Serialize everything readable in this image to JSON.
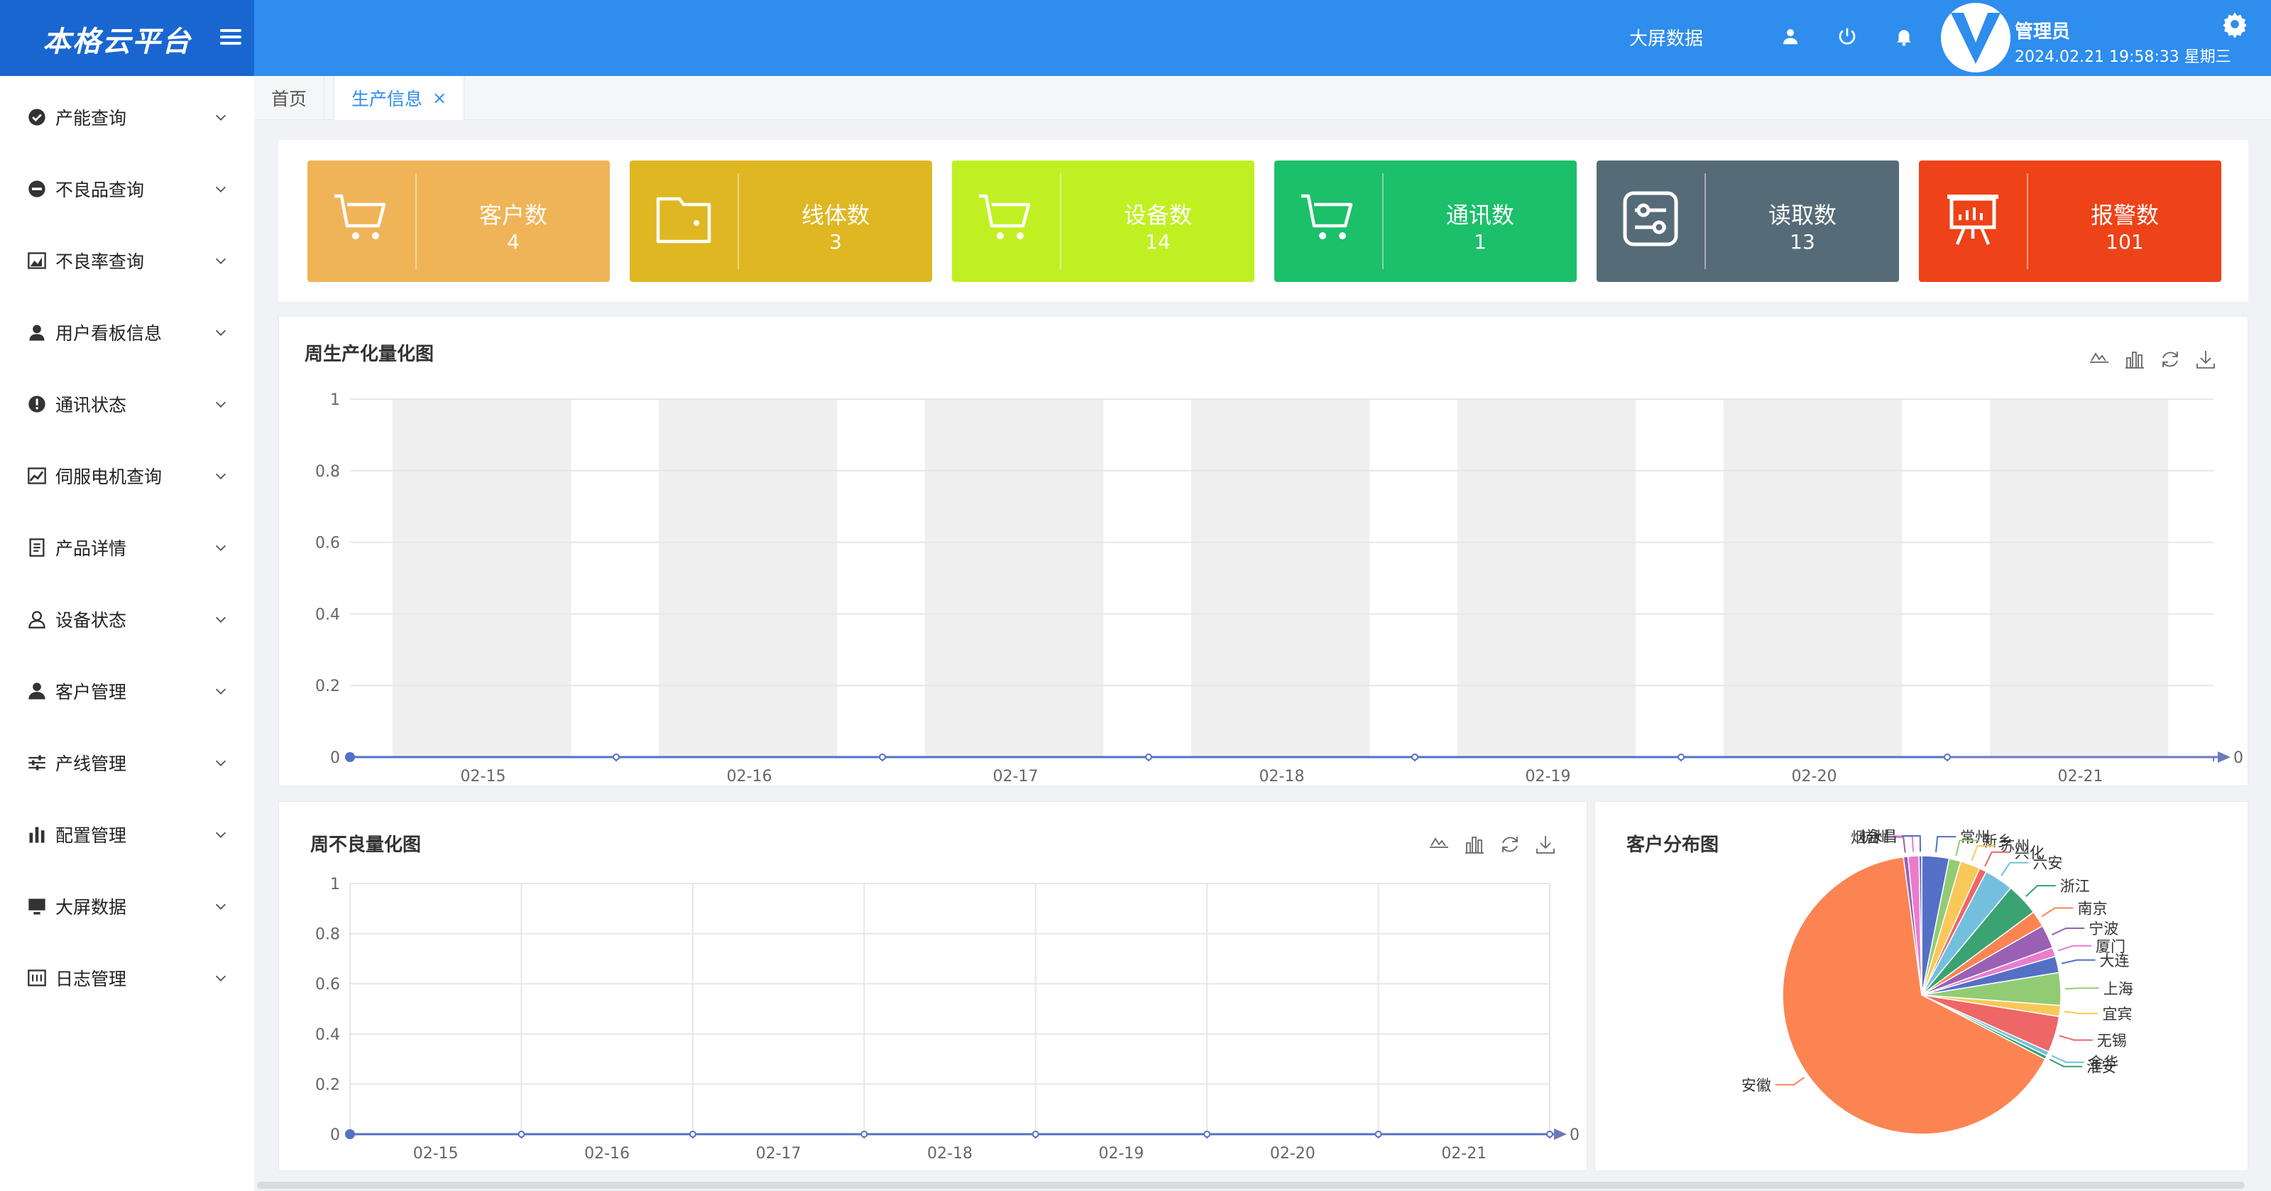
{
  "app": {
    "logo_text": "本格云平台"
  },
  "header": {
    "big_screen_label": "大屏数据",
    "user_name": "管理员",
    "user_time": "2024.02.21 19:58:33 星期三",
    "icons": [
      "user-icon",
      "power-icon",
      "bell-icon",
      "settings-icon"
    ]
  },
  "sidebar": {
    "items": [
      {
        "label": "产能查询",
        "icon": "check-circle-icon"
      },
      {
        "label": "不良品查询",
        "icon": "minus-circle-icon"
      },
      {
        "label": "不良率查询",
        "icon": "area-chart-icon"
      },
      {
        "label": "用户看板信息",
        "icon": "user-icon"
      },
      {
        "label": "通讯状态",
        "icon": "exclamation-circle-icon"
      },
      {
        "label": "伺服电机查询",
        "icon": "line-chart-icon"
      },
      {
        "label": "产品详情",
        "icon": "document-icon"
      },
      {
        "label": "设备状态",
        "icon": "user-outline-icon"
      },
      {
        "label": "客户管理",
        "icon": "person-icon"
      },
      {
        "label": "产线管理",
        "icon": "sliders-icon"
      },
      {
        "label": "配置管理",
        "icon": "bar-chart-icon"
      },
      {
        "label": "大屏数据",
        "icon": "monitor-icon"
      },
      {
        "label": "日志管理",
        "icon": "log-icon"
      }
    ]
  },
  "tabs": {
    "home": "首页",
    "active": "生产信息",
    "close_glyph": "×"
  },
  "cards": [
    {
      "label": "客户数",
      "value": "4",
      "color": "#f0b458",
      "icon": "cart-icon"
    },
    {
      "label": "线体数",
      "value": "3",
      "color": "#deb722",
      "icon": "wallet-icon"
    },
    {
      "label": "设备数",
      "value": "14",
      "color": "#c0f022",
      "icon": "cart-icon"
    },
    {
      "label": "通讯数",
      "value": "1",
      "color": "#1cbf6a",
      "icon": "cart-icon"
    },
    {
      "label": "读取数",
      "value": "13",
      "color": "#566b78",
      "icon": "settings-panel-icon"
    },
    {
      "label": "报警数",
      "value": "101",
      "color": "#ee4218",
      "icon": "presentation-icon"
    }
  ],
  "weekly_production": {
    "title": "周生产化量化图",
    "toolbox": [
      "line-switch-icon",
      "bar-switch-icon",
      "restore-icon",
      "download-icon"
    ]
  },
  "weekly_defects": {
    "title": "周不良量化图",
    "toolbox": [
      "line-switch-icon",
      "bar-switch-icon",
      "restore-icon",
      "download-icon"
    ]
  },
  "customer_distribution": {
    "title": "客户分布图"
  },
  "chart_data": [
    {
      "type": "line",
      "title": "周生产化量化图",
      "categories": [
        "02-15",
        "02-16",
        "02-17",
        "02-18",
        "02-19",
        "02-20",
        "02-21"
      ],
      "series": [
        {
          "values": [
            0,
            0,
            0,
            0,
            0,
            0,
            0
          ],
          "color": "#5470c6"
        }
      ],
      "y_ticks": [
        "0",
        "0.2",
        "0.4",
        "0.6",
        "0.8",
        "1"
      ],
      "ylim": [
        0,
        1
      ],
      "x_axis_end_label": "0",
      "split_area": true,
      "grid": true
    },
    {
      "type": "line",
      "title": "周不良量化图",
      "categories": [
        "02-15",
        "02-16",
        "02-17",
        "02-18",
        "02-19",
        "02-20",
        "02-21"
      ],
      "series": [
        {
          "values": [
            0,
            0,
            0,
            0,
            0,
            0,
            0,
            0
          ],
          "color": "#5470c6"
        }
      ],
      "y_ticks": [
        "0",
        "0.2",
        "0.4",
        "0.6",
        "0.8",
        "1"
      ],
      "ylim": [
        0,
        1
      ],
      "x_axis_end_label": "0",
      "grid": true
    },
    {
      "type": "pie",
      "title": "客户分布图",
      "slices": [
        {
          "label": "常州",
          "value": 3.0,
          "color": "#5470c6"
        },
        {
          "label": "新乡",
          "value": 1.3,
          "color": "#91cc75"
        },
        {
          "label": "苏州",
          "value": 2.2,
          "color": "#fac858"
        },
        {
          "label": "兴化",
          "value": 0.8,
          "color": "#ee6666"
        },
        {
          "label": "六安",
          "value": 3.2,
          "color": "#73c0de"
        },
        {
          "label": "浙江",
          "value": 3.6,
          "color": "#3ba272"
        },
        {
          "label": "南京",
          "value": 1.8,
          "color": "#fc8452"
        },
        {
          "label": "宁波",
          "value": 2.6,
          "color": "#9a60b4"
        },
        {
          "label": "厦门",
          "value": 1.0,
          "color": "#ea7ccc"
        },
        {
          "label": "大连",
          "value": 1.8,
          "color": "#5470c6"
        },
        {
          "label": "上海",
          "value": 3.6,
          "color": "#91cc75"
        },
        {
          "label": "宜宾",
          "value": 1.2,
          "color": "#fac858"
        },
        {
          "label": "无锡",
          "value": 4.0,
          "color": "#ee6666"
        },
        {
          "label": "金华",
          "value": 0.5,
          "color": "#73c0de"
        },
        {
          "label": "淮安",
          "value": 0.4,
          "color": "#3ba272"
        },
        {
          "label": "安徽",
          "value": 62.0,
          "color": "#fc8452"
        },
        {
          "label": "烟台",
          "value": 0.5,
          "color": "#9a60b4"
        },
        {
          "label": "杭州",
          "value": 1.2,
          "color": "#ea7ccc"
        },
        {
          "label": "永昌",
          "value": 0.3,
          "color": "#5470c6"
        }
      ]
    }
  ]
}
